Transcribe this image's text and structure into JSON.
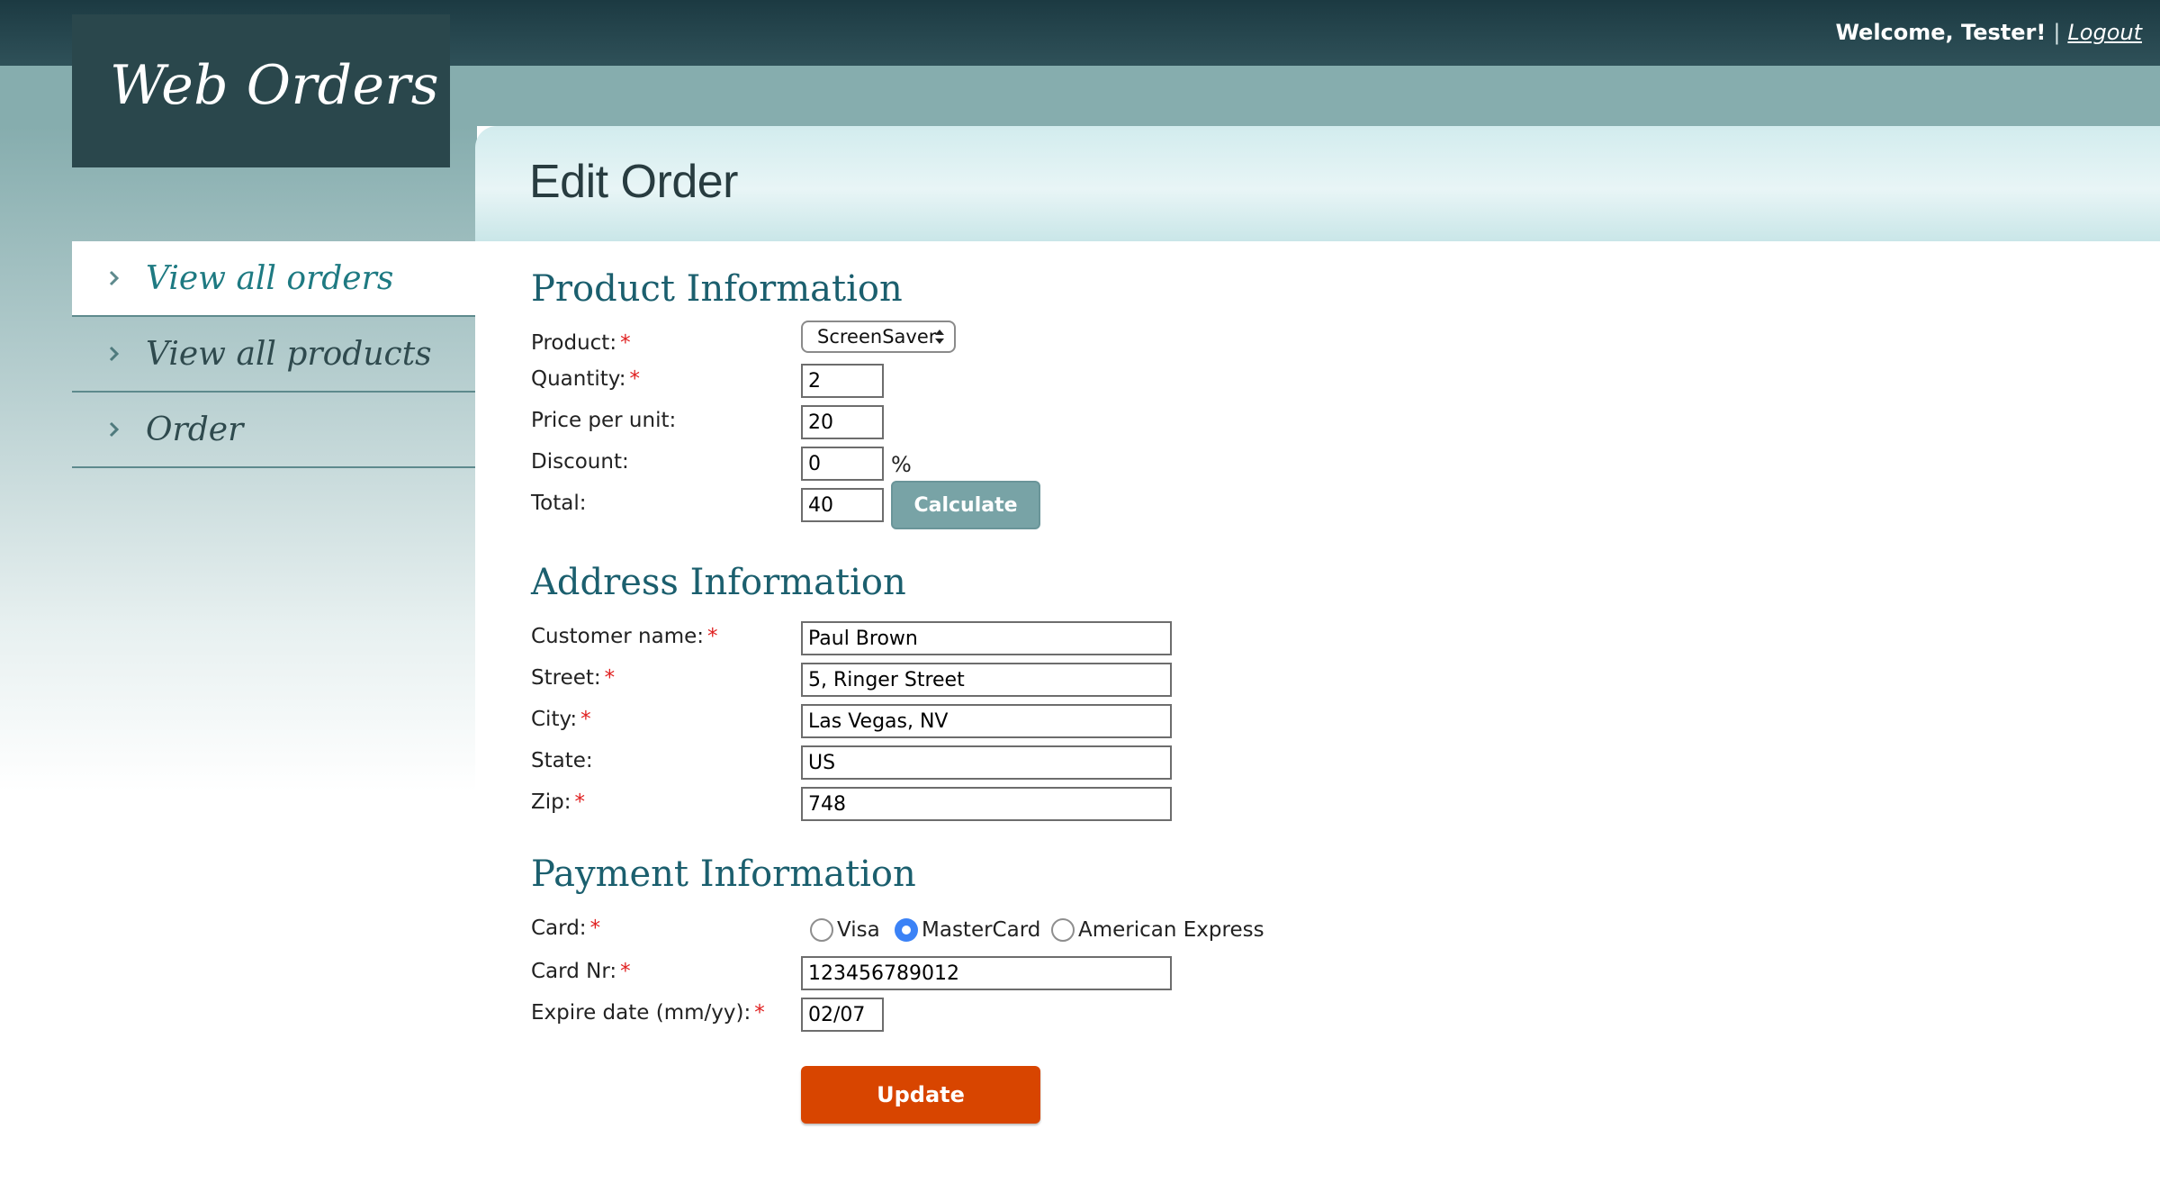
{
  "header": {
    "logo": "Web Orders",
    "welcome": "Welcome, Tester!",
    "separator": "|",
    "logout": "Logout"
  },
  "nav": {
    "items": [
      {
        "label": "View all orders",
        "icon": "chevron-right-icon",
        "active": true
      },
      {
        "label": "View all products",
        "icon": "chevron-right-icon"
      },
      {
        "label": "Order",
        "icon": "chevron-right-icon"
      }
    ]
  },
  "page": {
    "title": "Edit Order"
  },
  "product": {
    "section_title": "Product Information",
    "product_label": "Product:",
    "product_value": "ScreenSaver",
    "quantity_label": "Quantity:",
    "quantity_value": "2",
    "price_label": "Price per unit:",
    "price_value": "20",
    "discount_label": "Discount:",
    "discount_value": "0",
    "discount_unit": "%",
    "total_label": "Total:",
    "total_value": "40",
    "calculate_label": "Calculate"
  },
  "address": {
    "section_title": "Address Information",
    "customer_label": "Customer name:",
    "customer_value": "Paul Brown",
    "street_label": "Street:",
    "street_value": "5, Ringer Street",
    "city_label": "City:",
    "city_value": "Las Vegas, NV",
    "state_label": "State:",
    "state_value": "US",
    "zip_label": "Zip:",
    "zip_value": "748"
  },
  "payment": {
    "section_title": "Payment Information",
    "card_label": "Card:",
    "card_options": [
      "Visa",
      "MasterCard",
      "American Express"
    ],
    "card_selected": "MasterCard",
    "card_nr_label": "Card Nr:",
    "card_nr_value": "123456789012",
    "expire_label": "Expire date (mm/yy):",
    "expire_value": "02/07",
    "update_label": "Update"
  },
  "colors": {
    "accent": "#1b5f6e",
    "update_button": "#d84500",
    "calculate_button": "#78a3a6",
    "required": "#e02020",
    "radio_checked": "#3b82f6"
  }
}
